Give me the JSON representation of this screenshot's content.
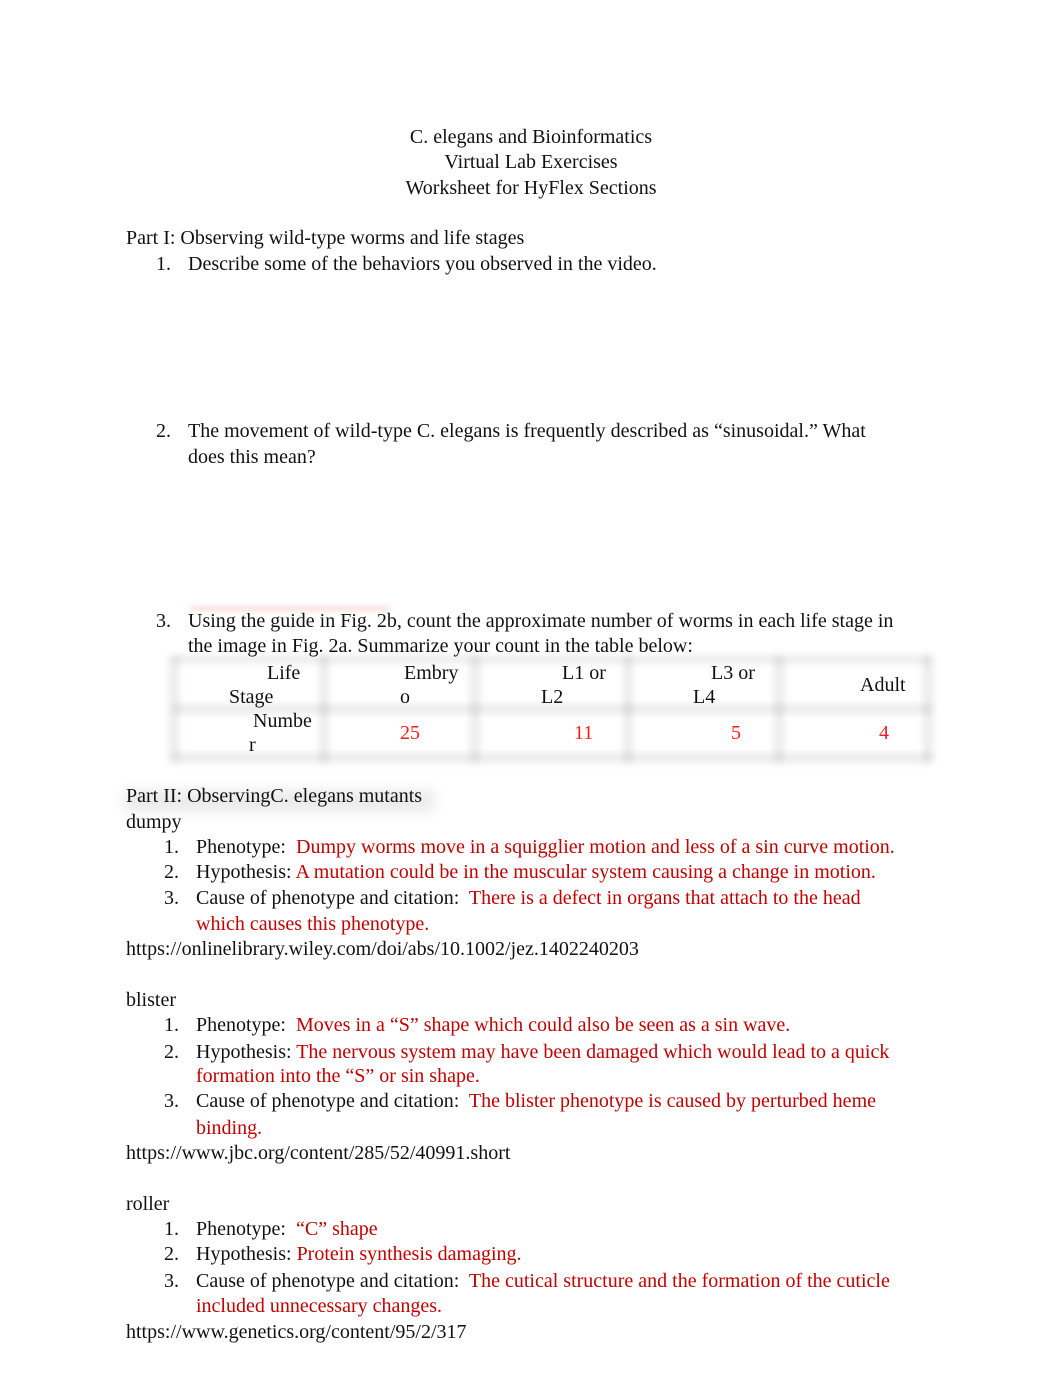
{
  "header": {
    "line1": "C. elegans and Bioinformatics",
    "line2": "Virtual Lab Exercises",
    "line3": "Worksheet for HyFlex Sections"
  },
  "part1": {
    "heading": "Part I: Observing wild-type worms and life stages",
    "questions": [
      {
        "num": "1.",
        "text": "Describe some of the behaviors you observed in the video."
      },
      {
        "num": "2.",
        "text_line1": "The movement of wild-type C. elegans is frequently described as “sinusoidal.” What",
        "text_line2": "does this mean?"
      },
      {
        "num": "3.",
        "text_line1": "Using the guide in Fig. 2b, count the approximate number of worms in each life stage in",
        "text_line2": "the image in Fig. 2a. Summarize your count in the table below:"
      }
    ],
    "table": {
      "header": [
        {
          "l1": "Life",
          "l2": "Stage"
        },
        {
          "l1": "Embry",
          "l2": "o"
        },
        {
          "l1": "L1 or",
          "l2": "L2"
        },
        {
          "l1": "L3 or",
          "l2": "L4"
        },
        {
          "l1": "Adult",
          "l2": ""
        }
      ],
      "row_label": {
        "l1": "Numbe",
        "l2": "r"
      },
      "values": [
        "25",
        "11",
        "5",
        "4"
      ]
    }
  },
  "part2": {
    "heading": "Part II: ObservingC. elegans mutants",
    "mutants": [
      {
        "name": "dumpy",
        "phenotype_label": "Phenotype:",
        "phenotype": "Dumpy worms move in a squigglier motion and less of a sin curve motion.",
        "hypothesis_label": "Hypothesis:",
        "hypothesis_l1": "A mutation could be in the muscular system causing a change in motion.",
        "hypothesis_l2": "",
        "cause_label": "Cause of phenotype and citation:",
        "cause_l1": "There is a defect in organs that attach to the head",
        "cause_l2": "which causes this phenotype.",
        "citation": "https://onlinelibrary.wiley.com/doi/abs/10.1002/jez.1402240203"
      },
      {
        "name": "blister",
        "phenotype_label": "Phenotype:",
        "phenotype": "Moves in a “S” shape which could also be seen as a sin wave.",
        "hypothesis_label": "Hypothesis:",
        "hypothesis_l1": "The nervous system may have been damaged which would lead to a quick",
        "hypothesis_l2": "formation into the “S” or sin shape.",
        "cause_label": "Cause of phenotype and citation:",
        "cause_l1": "The blister phenotype is caused by perturbed heme",
        "cause_l2": "binding.",
        "citation": "https://www.jbc.org/content/285/52/40991.short"
      },
      {
        "name": "roller",
        "phenotype_label": "Phenotype:",
        "phenotype": "“C” shape",
        "hypothesis_label": "Hypothesis:",
        "hypothesis_l1": "Protein synthesis damaging.",
        "hypothesis_l2": "",
        "cause_label": "Cause of phenotype and citation:",
        "cause_l1": "The cutical structure and the formation of the cuticle",
        "cause_l2": "included unnecessary changes.",
        "citation": "https://www.genetics.org/content/95/2/317"
      }
    ],
    "item_nums": [
      "1.",
      "2.",
      "3."
    ]
  }
}
